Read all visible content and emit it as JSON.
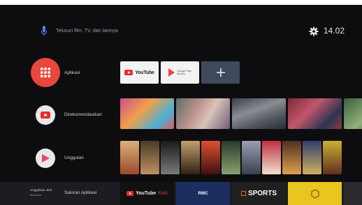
{
  "topbar": {
    "search_placeholder": "Telusuri film, TV, dan lainnya",
    "time": "14.02"
  },
  "rows": [
    {
      "label": "Aplikasi",
      "icon": "apps-grid-icon"
    },
    {
      "label": "Direkomendasikan",
      "icon": "youtube-icon"
    },
    {
      "label": "Unggulan",
      "icon": "play-movies-icon"
    }
  ],
  "apps": [
    {
      "name": "YouTube",
      "text": "YouTube"
    },
    {
      "name": "Google Play Movies",
      "text_line1": "Google Play",
      "text_line2": "Movies"
    },
    {
      "name": "Add app",
      "icon": "plus-icon"
    }
  ],
  "bottom": {
    "title_line1": "Unggulkan oleh",
    "title_line2": "Bersama",
    "label": "Saluran Aplikasi",
    "tiles": {
      "ytkids_text": "YouTube",
      "ytkids_suffix": "Kids",
      "rwc_text": "RWC",
      "sports_text": "SPORTS"
    }
  },
  "colors": {
    "background": "#0d0d0f",
    "accent": "#e9473e",
    "youtube_red": "#e52d27",
    "add_tile": "#3f4a5c",
    "bottom_strip": "#1c1d22",
    "sports_orange": "#e8622e",
    "yellow_tile": "#e8c51f",
    "rwc_blue": "#1c2e60"
  }
}
